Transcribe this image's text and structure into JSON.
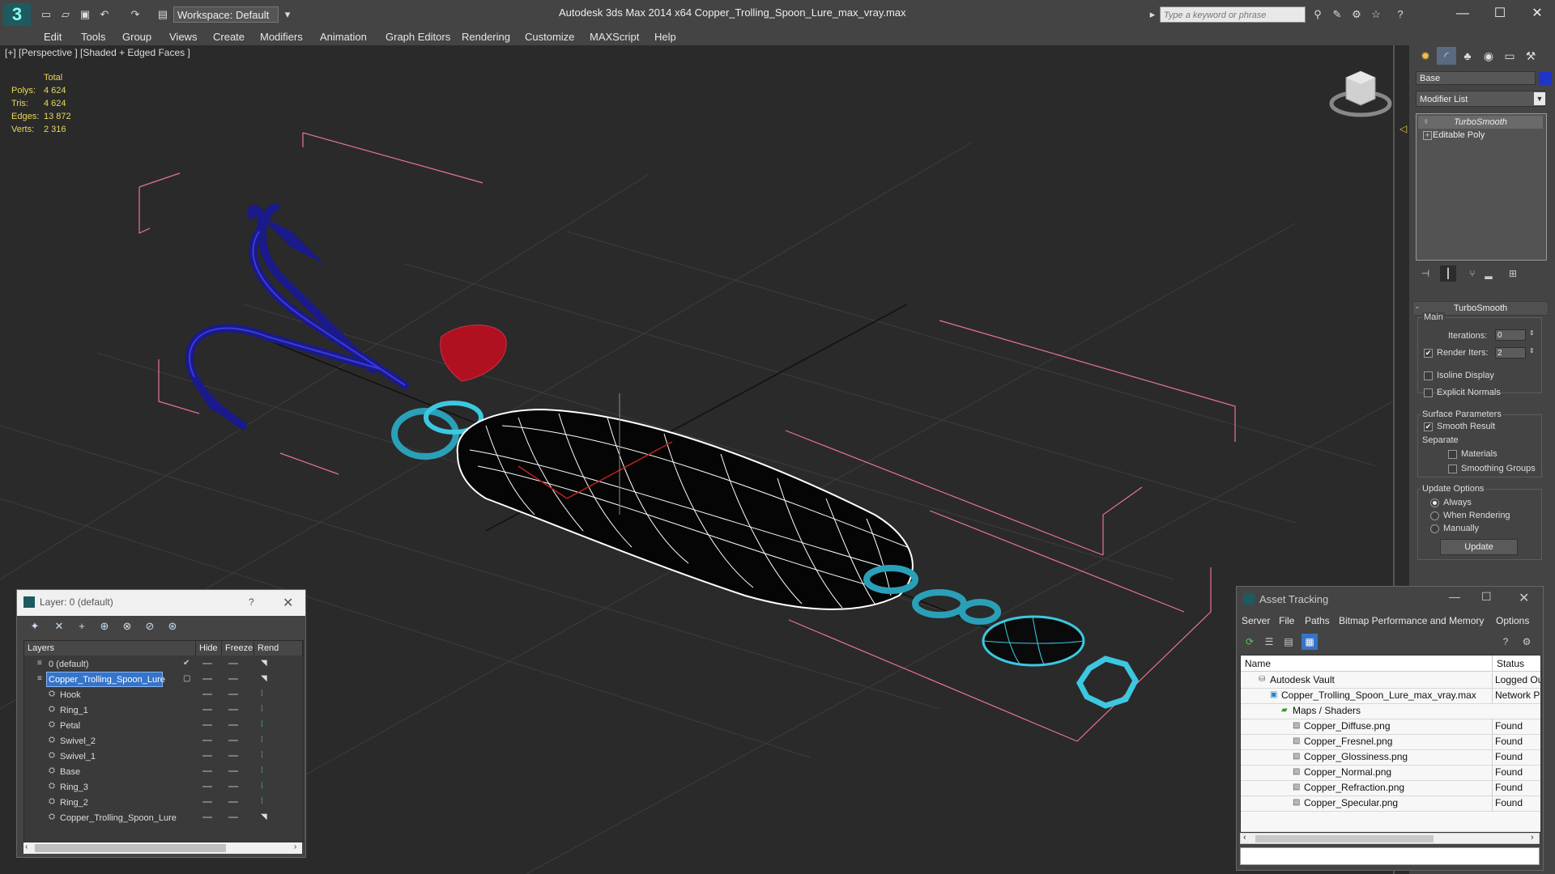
{
  "app": {
    "title": "Autodesk 3ds Max  2014 x64     Copper_Trolling_Spoon_Lure_max_vray.max",
    "workspace": "Workspace: Default",
    "search_placeholder": "Type a keyword or phrase"
  },
  "menu": [
    "Edit",
    "Tools",
    "Group",
    "Views",
    "Create",
    "Modifiers",
    "Animation",
    "Graph Editors",
    "Rendering",
    "Customize",
    "MAXScript",
    "Help"
  ],
  "viewport": {
    "label": "[+] [Perspective ] [Shaded + Edged Faces ]",
    "stats": {
      "header": "Total",
      "rows": [
        {
          "k": "Polys:",
          "v": "4 624"
        },
        {
          "k": "Tris:",
          "v": "4 624"
        },
        {
          "k": "Edges:",
          "v": "13 872"
        },
        {
          "k": "Verts:",
          "v": "2 316"
        }
      ]
    }
  },
  "command_panel": {
    "object_name": "Base",
    "object_color": "#2034c8",
    "modifier_list": "Modifier List",
    "stack": [
      "TurboSmooth",
      "Editable Poly"
    ],
    "rollout_title": "TurboSmooth",
    "main_label": "Main",
    "iterations_label": "Iterations:",
    "iterations_value": "0",
    "render_iters_label": "Render Iters:",
    "render_iters_value": "2",
    "isoline_display": "Isoline Display",
    "explicit_normals": "Explicit Normals",
    "surface_parameters": "Surface Parameters",
    "smooth_result": "Smooth Result",
    "separate": "Separate",
    "materials": "Materials",
    "smoothing_groups": "Smoothing Groups",
    "update_options": "Update Options",
    "always": "Always",
    "when_rendering": "When Rendering",
    "manually": "Manually",
    "update": "Update"
  },
  "layer_dialog": {
    "title": "Layer: 0 (default)",
    "help": "?",
    "columns": [
      "Layers",
      "Hide",
      "Freeze",
      "Rend"
    ],
    "rows": [
      {
        "name": "0 (default)",
        "indent": 0,
        "selected": false
      },
      {
        "name": "Copper_Trolling_Spoon_Lure",
        "indent": 0,
        "selected": true
      },
      {
        "name": "Hook",
        "indent": 1,
        "selected": false
      },
      {
        "name": "Ring_1",
        "indent": 1,
        "selected": false
      },
      {
        "name": "Petal",
        "indent": 1,
        "selected": false
      },
      {
        "name": "Swivel_2",
        "indent": 1,
        "selected": false
      },
      {
        "name": "Swivel_1",
        "indent": 1,
        "selected": false
      },
      {
        "name": "Base",
        "indent": 1,
        "selected": false
      },
      {
        "name": "Ring_3",
        "indent": 1,
        "selected": false
      },
      {
        "name": "Ring_2",
        "indent": 1,
        "selected": false
      },
      {
        "name": "Copper_Trolling_Spoon_Lure",
        "indent": 1,
        "selected": false
      }
    ]
  },
  "asset_tracking": {
    "title": "Asset Tracking",
    "menu": [
      "Server",
      "File",
      "Paths",
      "Bitmap Performance and Memory",
      "Options"
    ],
    "columns": [
      "Name",
      "Status"
    ],
    "rows": [
      {
        "name": "Autodesk Vault",
        "status": "Logged Ou",
        "indent": 1,
        "icon": "vault-icon"
      },
      {
        "name": "Copper_Trolling_Spoon_Lure_max_vray.max",
        "status": "Network P",
        "indent": 2,
        "icon": "max-file-icon"
      },
      {
        "name": "Maps / Shaders",
        "status": "",
        "indent": 3,
        "icon": "maps-folder-icon"
      },
      {
        "name": "Copper_Diffuse.png",
        "status": "Found",
        "indent": 4,
        "icon": "image-file-icon"
      },
      {
        "name": "Copper_Fresnel.png",
        "status": "Found",
        "indent": 4,
        "icon": "image-file-icon"
      },
      {
        "name": "Copper_Glossiness.png",
        "status": "Found",
        "indent": 4,
        "icon": "image-file-icon"
      },
      {
        "name": "Copper_Normal.png",
        "status": "Found",
        "indent": 4,
        "icon": "image-file-icon"
      },
      {
        "name": "Copper_Refraction.png",
        "status": "Found",
        "indent": 4,
        "icon": "image-file-icon"
      },
      {
        "name": "Copper_Specular.png",
        "status": "Found",
        "indent": 4,
        "icon": "image-file-icon"
      }
    ]
  }
}
